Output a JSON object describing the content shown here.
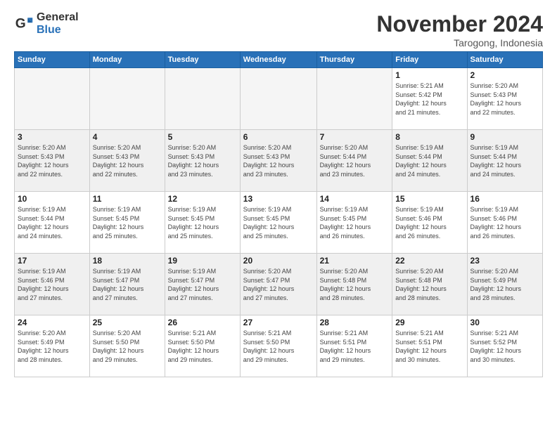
{
  "logo": {
    "text_general": "General",
    "text_blue": "Blue"
  },
  "title": "November 2024",
  "location": "Tarogong, Indonesia",
  "weekdays": [
    "Sunday",
    "Monday",
    "Tuesday",
    "Wednesday",
    "Thursday",
    "Friday",
    "Saturday"
  ],
  "weeks": [
    [
      {
        "day": "",
        "info": ""
      },
      {
        "day": "",
        "info": ""
      },
      {
        "day": "",
        "info": ""
      },
      {
        "day": "",
        "info": ""
      },
      {
        "day": "",
        "info": ""
      },
      {
        "day": "1",
        "info": "Sunrise: 5:21 AM\nSunset: 5:42 PM\nDaylight: 12 hours\nand 21 minutes."
      },
      {
        "day": "2",
        "info": "Sunrise: 5:20 AM\nSunset: 5:43 PM\nDaylight: 12 hours\nand 22 minutes."
      }
    ],
    [
      {
        "day": "3",
        "info": "Sunrise: 5:20 AM\nSunset: 5:43 PM\nDaylight: 12 hours\nand 22 minutes."
      },
      {
        "day": "4",
        "info": "Sunrise: 5:20 AM\nSunset: 5:43 PM\nDaylight: 12 hours\nand 22 minutes."
      },
      {
        "day": "5",
        "info": "Sunrise: 5:20 AM\nSunset: 5:43 PM\nDaylight: 12 hours\nand 23 minutes."
      },
      {
        "day": "6",
        "info": "Sunrise: 5:20 AM\nSunset: 5:43 PM\nDaylight: 12 hours\nand 23 minutes."
      },
      {
        "day": "7",
        "info": "Sunrise: 5:20 AM\nSunset: 5:44 PM\nDaylight: 12 hours\nand 23 minutes."
      },
      {
        "day": "8",
        "info": "Sunrise: 5:19 AM\nSunset: 5:44 PM\nDaylight: 12 hours\nand 24 minutes."
      },
      {
        "day": "9",
        "info": "Sunrise: 5:19 AM\nSunset: 5:44 PM\nDaylight: 12 hours\nand 24 minutes."
      }
    ],
    [
      {
        "day": "10",
        "info": "Sunrise: 5:19 AM\nSunset: 5:44 PM\nDaylight: 12 hours\nand 24 minutes."
      },
      {
        "day": "11",
        "info": "Sunrise: 5:19 AM\nSunset: 5:45 PM\nDaylight: 12 hours\nand 25 minutes."
      },
      {
        "day": "12",
        "info": "Sunrise: 5:19 AM\nSunset: 5:45 PM\nDaylight: 12 hours\nand 25 minutes."
      },
      {
        "day": "13",
        "info": "Sunrise: 5:19 AM\nSunset: 5:45 PM\nDaylight: 12 hours\nand 25 minutes."
      },
      {
        "day": "14",
        "info": "Sunrise: 5:19 AM\nSunset: 5:45 PM\nDaylight: 12 hours\nand 26 minutes."
      },
      {
        "day": "15",
        "info": "Sunrise: 5:19 AM\nSunset: 5:46 PM\nDaylight: 12 hours\nand 26 minutes."
      },
      {
        "day": "16",
        "info": "Sunrise: 5:19 AM\nSunset: 5:46 PM\nDaylight: 12 hours\nand 26 minutes."
      }
    ],
    [
      {
        "day": "17",
        "info": "Sunrise: 5:19 AM\nSunset: 5:46 PM\nDaylight: 12 hours\nand 27 minutes."
      },
      {
        "day": "18",
        "info": "Sunrise: 5:19 AM\nSunset: 5:47 PM\nDaylight: 12 hours\nand 27 minutes."
      },
      {
        "day": "19",
        "info": "Sunrise: 5:19 AM\nSunset: 5:47 PM\nDaylight: 12 hours\nand 27 minutes."
      },
      {
        "day": "20",
        "info": "Sunrise: 5:20 AM\nSunset: 5:47 PM\nDaylight: 12 hours\nand 27 minutes."
      },
      {
        "day": "21",
        "info": "Sunrise: 5:20 AM\nSunset: 5:48 PM\nDaylight: 12 hours\nand 28 minutes."
      },
      {
        "day": "22",
        "info": "Sunrise: 5:20 AM\nSunset: 5:48 PM\nDaylight: 12 hours\nand 28 minutes."
      },
      {
        "day": "23",
        "info": "Sunrise: 5:20 AM\nSunset: 5:49 PM\nDaylight: 12 hours\nand 28 minutes."
      }
    ],
    [
      {
        "day": "24",
        "info": "Sunrise: 5:20 AM\nSunset: 5:49 PM\nDaylight: 12 hours\nand 28 minutes."
      },
      {
        "day": "25",
        "info": "Sunrise: 5:20 AM\nSunset: 5:50 PM\nDaylight: 12 hours\nand 29 minutes."
      },
      {
        "day": "26",
        "info": "Sunrise: 5:21 AM\nSunset: 5:50 PM\nDaylight: 12 hours\nand 29 minutes."
      },
      {
        "day": "27",
        "info": "Sunrise: 5:21 AM\nSunset: 5:50 PM\nDaylight: 12 hours\nand 29 minutes."
      },
      {
        "day": "28",
        "info": "Sunrise: 5:21 AM\nSunset: 5:51 PM\nDaylight: 12 hours\nand 29 minutes."
      },
      {
        "day": "29",
        "info": "Sunrise: 5:21 AM\nSunset: 5:51 PM\nDaylight: 12 hours\nand 30 minutes."
      },
      {
        "day": "30",
        "info": "Sunrise: 5:21 AM\nSunset: 5:52 PM\nDaylight: 12 hours\nand 30 minutes."
      }
    ]
  ]
}
